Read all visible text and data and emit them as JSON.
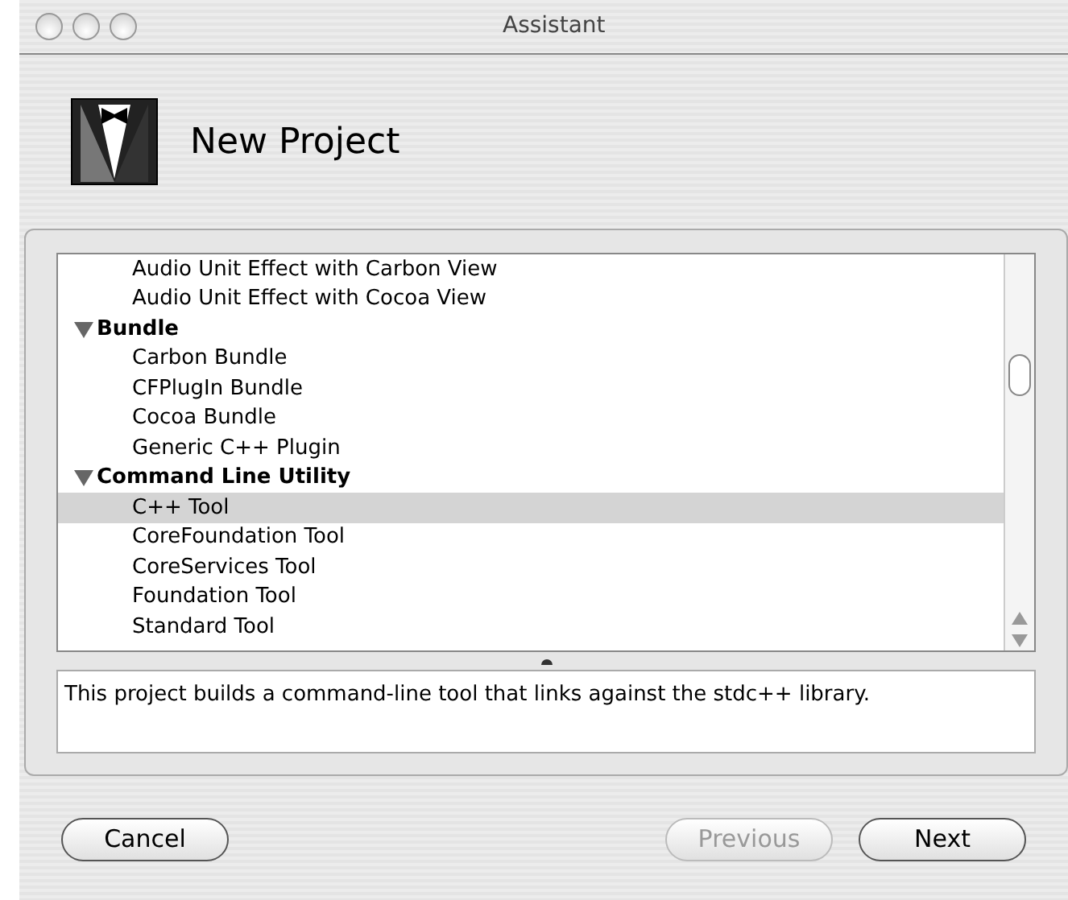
{
  "window": {
    "title": "Assistant"
  },
  "header": {
    "title": "New Project"
  },
  "tree": [
    {
      "kind": "item",
      "label": "Audio Unit Effect with Carbon View",
      "selected": false
    },
    {
      "kind": "item",
      "label": "Audio Unit Effect with Cocoa View",
      "selected": false
    },
    {
      "kind": "group",
      "label": "Bundle",
      "expanded": true,
      "children": [
        {
          "kind": "item",
          "label": "Carbon Bundle",
          "selected": false
        },
        {
          "kind": "item",
          "label": "CFPlugIn Bundle",
          "selected": false
        },
        {
          "kind": "item",
          "label": "Cocoa Bundle",
          "selected": false
        },
        {
          "kind": "item",
          "label": "Generic C++ Plugin",
          "selected": false
        }
      ]
    },
    {
      "kind": "group",
      "label": "Command Line Utility",
      "expanded": true,
      "children": [
        {
          "kind": "item",
          "label": "C++ Tool",
          "selected": true
        },
        {
          "kind": "item",
          "label": "CoreFoundation Tool",
          "selected": false
        },
        {
          "kind": "item",
          "label": "CoreServices Tool",
          "selected": false
        },
        {
          "kind": "item",
          "label": "Foundation Tool",
          "selected": false
        },
        {
          "kind": "item",
          "label": "Standard Tool",
          "selected": false
        }
      ]
    }
  ],
  "description": "This project builds a command-line tool that links against the stdc++ library.",
  "buttons": [
    {
      "label": "Cancel",
      "disabled": false
    },
    {
      "label": "Previous",
      "disabled": true
    },
    {
      "label": "Next",
      "disabled": false
    }
  ]
}
